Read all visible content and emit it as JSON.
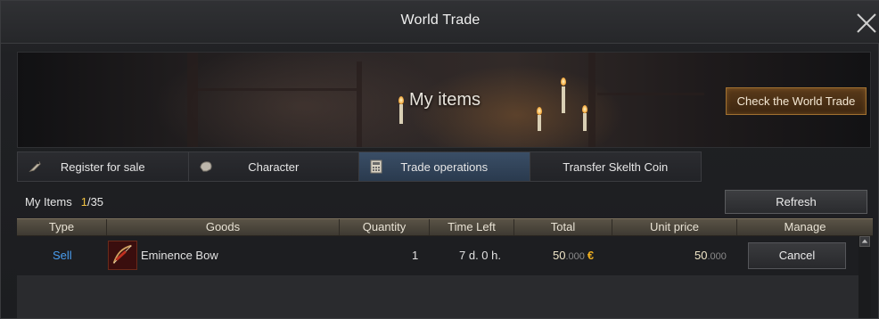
{
  "window": {
    "title": "World Trade"
  },
  "banner": {
    "title": "My items",
    "check_button": "Check the World Trade"
  },
  "tabs": [
    {
      "label": "Register for sale",
      "icon": "tag-icon",
      "active": false
    },
    {
      "label": "Character",
      "icon": "character-icon",
      "active": false
    },
    {
      "label": "Trade operations",
      "icon": "calculator-icon",
      "active": true
    },
    {
      "label": "Transfer Skelth Coin",
      "icon": "",
      "active": false
    }
  ],
  "summary": {
    "label": "My Items",
    "count": "1",
    "max": "/35"
  },
  "toolbar": {
    "refresh": "Refresh"
  },
  "table": {
    "columns": [
      "Type",
      "Goods",
      "Quantity",
      "Time Left",
      "Total",
      "Unit price",
      "Manage"
    ],
    "rows": [
      {
        "type": "Sell",
        "goods": "Eminence Bow",
        "quantity": "1",
        "time_left": "7 d. 0 h.",
        "total_int": "50",
        "total_dec": ".000",
        "currency": "€",
        "unit_int": "50",
        "unit_dec": ".000",
        "manage": "Cancel"
      }
    ]
  },
  "colors": {
    "accent_sell": "#4a9ef0",
    "count": "#f0c040",
    "currency": "#f0b020"
  }
}
